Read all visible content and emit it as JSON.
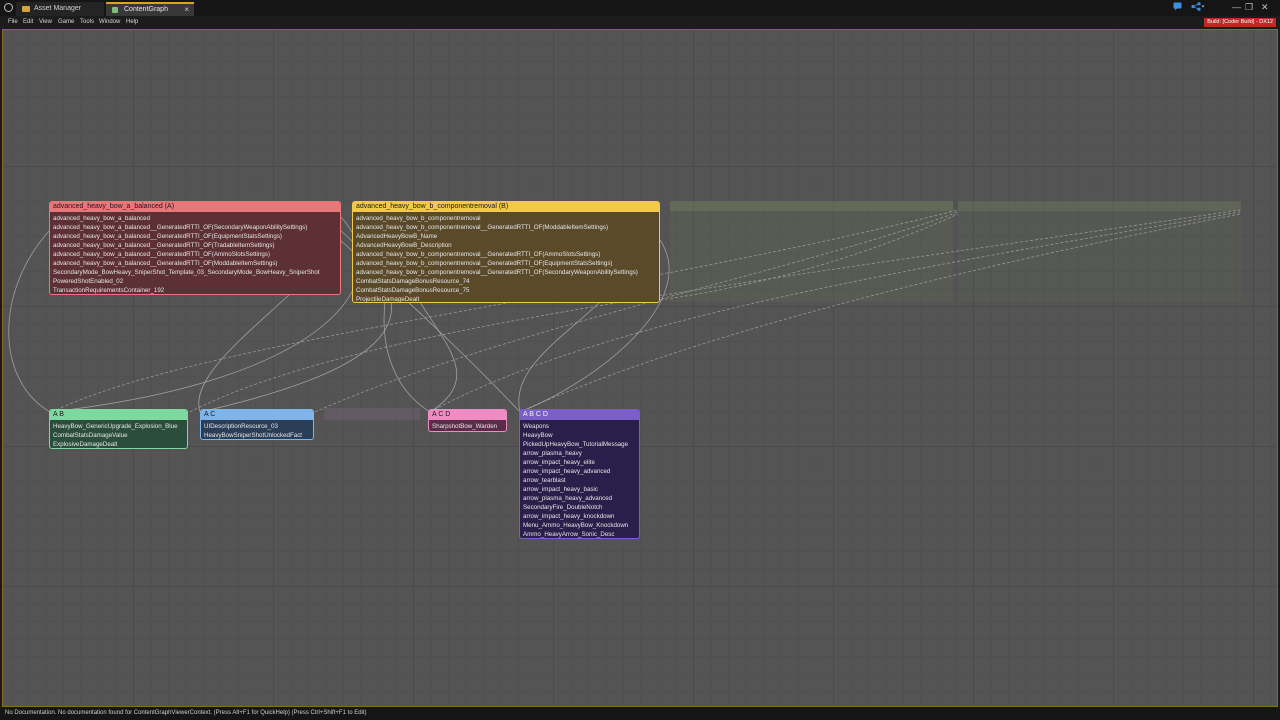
{
  "tabs": [
    {
      "label": "Asset Manager"
    },
    {
      "label": "ContentGraph"
    }
  ],
  "tab_close_glyph": "×",
  "window_controls": [
    "—",
    "❐",
    "✕"
  ],
  "menu": [
    "File",
    "Edit",
    "View",
    "Game",
    "Tools",
    "Window",
    "Help"
  ],
  "build_badge": "Build: [Coder Build] - DX12",
  "status_text": "No Documentation. No documentation found for ContentGraphViewerContext. (Press Alt+F1 for QuickHelp) (Press Ctrl+Shift+F1 to Edit)",
  "colors": {
    "accent": "#e0a021",
    "node_a": "#e8777a",
    "node_b": "#f2c94c",
    "node_ab": "#7ed9a0",
    "node_ac": "#7fb5e8",
    "node_acd": "#f08cc4",
    "node_abcd": "#7b5fc9"
  },
  "nodes": {
    "a": {
      "title": "advanced_heavy_bow_a_balanced (A)",
      "rows": [
        "advanced_heavy_bow_a_balanced",
        "advanced_heavy_bow_a_balanced__GeneratedRTTI_OF(SecondaryWeaponAbilitySettings)",
        "advanced_heavy_bow_a_balanced__GeneratedRTTI_OF(EquipmentStatsSettings)",
        "advanced_heavy_bow_a_balanced__GeneratedRTTI_OF(TradableItemSettings)",
        "advanced_heavy_bow_a_balanced__GeneratedRTTI_OF(AmmoSlotsSettings)",
        "advanced_heavy_bow_a_balanced__GeneratedRTTI_OF(ModdableItemSettings)",
        "SecondaryMode_BowHeavy_SniperShot_Template_03_SecondaryMode_BowHeavy_SniperShot",
        "PoweredShotEnabled_02",
        "TransactionRequirementsContainer_192"
      ]
    },
    "b": {
      "title": "advanced_heavy_bow_b_componentremoval (B)",
      "rows": [
        "advanced_heavy_bow_b_componentremoval",
        "advanced_heavy_bow_b_componentremoval__GeneratedRTTI_OF(ModdableItemSettings)",
        "AdvancedHeavyBowB_Name",
        "AdvancedHeavyBowB_Description",
        "advanced_heavy_bow_b_componentremoval__GeneratedRTTI_OF(AmmoSlotsSettings)",
        "advanced_heavy_bow_b_componentremoval__GeneratedRTTI_OF(EquipmentStatsSettings)",
        "advanced_heavy_bow_b_componentremoval__GeneratedRTTI_OF(SecondaryWeaponAbilitySettings)",
        "CombatStatsDamageBonusResource_74",
        "CombatStatsDamageBonusResource_75",
        "ProjectileDamageDealt"
      ]
    },
    "ab": {
      "title": "A B",
      "rows": [
        "HeavyBow_GenericUpgrade_Explosion_Blue",
        "CombatStatsDamageValue",
        "ExplosiveDamageDealt"
      ]
    },
    "ac": {
      "title": "A C",
      "rows": [
        "UIDescriptionResource_03",
        "HeavyBowSniperShotUnlockedFact"
      ]
    },
    "acd": {
      "title": "A C D",
      "rows": [
        "SharpshotBow_Warden"
      ]
    },
    "abcd": {
      "title": "A B C D",
      "rows": [
        "Weapons",
        "HeavyBow",
        "PickedUpHeavyBow_TutorialMessage",
        "arrow_plasma_heavy",
        "arrow_impact_heavy_elite",
        "arrow_impact_heavy_advanced",
        "arrow_tearblast",
        "arrow_impact_heavy_basic",
        "arrow_plasma_heavy_advanced",
        "SecondaryFire_DoubleNotch",
        "arrow_impact_heavy_knockdown",
        "Menu_Ammo_HeavyBow_Knockdown",
        "Ammo_HeavyArrow_Sonic_Desc"
      ]
    }
  }
}
